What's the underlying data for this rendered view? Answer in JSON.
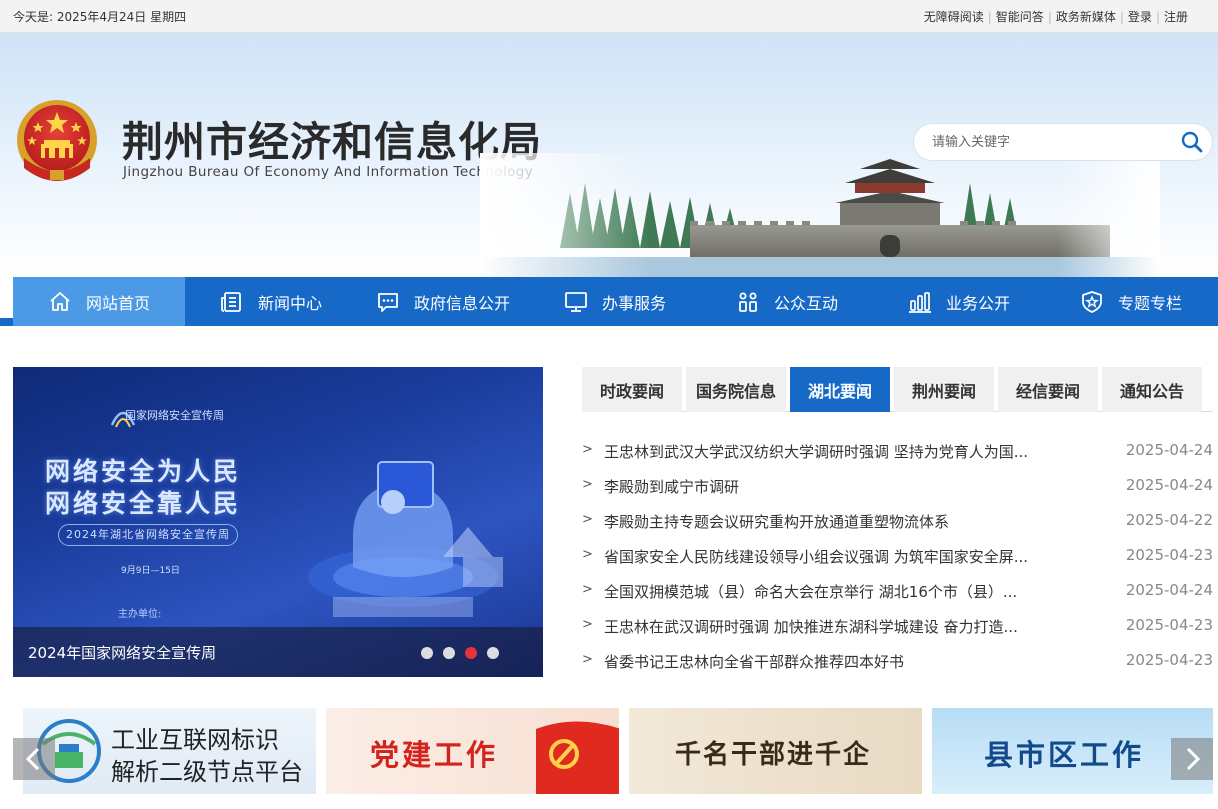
{
  "topbar": {
    "date": "今天是: 2025年4月24日 星期四",
    "links": [
      "无障碍阅读",
      "智能问答",
      "政务新媒体",
      "登录",
      "注册"
    ]
  },
  "header": {
    "title": "荆州市经济和信息化局",
    "subtitle": "Jingzhou Bureau Of Economy And Information Technology",
    "search_placeholder": "请输入关键字"
  },
  "nav": {
    "items": [
      {
        "label": "网站首页",
        "icon": "home-icon"
      },
      {
        "label": "新闻中心",
        "icon": "news-icon"
      },
      {
        "label": "政府信息公开",
        "icon": "chat-icon"
      },
      {
        "label": "办事服务",
        "icon": "monitor-icon"
      },
      {
        "label": "公众互动",
        "icon": "people-icon"
      },
      {
        "label": "业务公开",
        "icon": "bar-chart-icon"
      },
      {
        "label": "专题专栏",
        "icon": "badge-star-icon"
      }
    ],
    "active_index": 0
  },
  "slider": {
    "logo_text": "国家网络安全宣传周",
    "line1": "网络安全为人民",
    "line2": "网络安全靠人民",
    "pill": "2024年湖北省网络安全宣传周",
    "date": "9月9日—15日",
    "host": "主办单位:",
    "caption": "2024年国家网络安全宣传周",
    "dot_count": 4,
    "active_dot": 2
  },
  "news_tabs": {
    "tabs": [
      "时政要闻",
      "国务院信息",
      "湖北要闻",
      "荆州要闻",
      "经信要闻",
      "通知公告"
    ],
    "active_index": 2,
    "items": [
      {
        "title": "王忠林到武汉大学武汉纺织大学调研时强调 坚持为党育人为国...",
        "date": "2025-04-24"
      },
      {
        "title": "李殿勋到咸宁市调研",
        "date": "2025-04-24"
      },
      {
        "title": "李殿勋主持专题会议研究重构开放通道重塑物流体系",
        "date": "2025-04-22"
      },
      {
        "title": "省国家安全人民防线建设领导小组会议强调 为筑牢国家安全屏...",
        "date": "2025-04-23"
      },
      {
        "title": "全国双拥模范城（县）命名大会在京举行 湖北16个市（县）...",
        "date": "2025-04-24"
      },
      {
        "title": "王忠林在武汉调研时强调 加快推进东湖科学城建设 奋力打造...",
        "date": "2025-04-23"
      },
      {
        "title": "省委书记王忠林向全省干部群众推荐四本好书",
        "date": "2025-04-23"
      }
    ]
  },
  "features": {
    "f1_line1": "工业互联网标识",
    "f1_line2": "解析二级节点平台",
    "f2": "党建工作",
    "f3": "千名干部进千企",
    "f4": "县市区工作"
  },
  "colors": {
    "nav_blue": "#1769c8",
    "nav_active": "#4c9ae6",
    "dot_active": "#e8323c"
  }
}
